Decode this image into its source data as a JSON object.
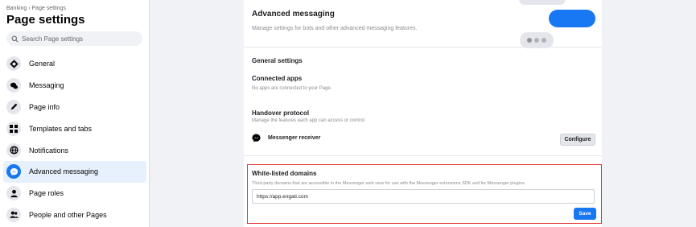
{
  "sidebar": {
    "breadcrumb": "Banking › Page settings",
    "title": "Page settings",
    "search_placeholder": "Search Page settings",
    "items": [
      {
        "label": "General",
        "icon": "gear-icon"
      },
      {
        "label": "Messaging",
        "icon": "chat-bubbles-icon"
      },
      {
        "label": "Page info",
        "icon": "pencil-icon"
      },
      {
        "label": "Templates and tabs",
        "icon": "grid-icon"
      },
      {
        "label": "Notifications",
        "icon": "globe-icon"
      },
      {
        "label": "Advanced messaging",
        "icon": "messenger-icon",
        "active": true
      },
      {
        "label": "Page roles",
        "icon": "person-icon"
      },
      {
        "label": "People and other Pages",
        "icon": "people-icon"
      }
    ]
  },
  "main": {
    "title": "Advanced messaging",
    "subtitle": "Manage settings for bots and other advanced messaging features.",
    "general_settings": "General settings",
    "connected_apps": {
      "title": "Connected apps",
      "subtitle": "No apps are connected to your Page."
    },
    "handover": {
      "title": "Handover protocol",
      "subtitle": "Manage the features each app can access or control.",
      "receiver_label": "Messenger receiver",
      "configure_label": "Configure"
    },
    "whitelist": {
      "title": "White-listed domains",
      "subtitle": "Third-party domains that are accessible in the Messenger web view for use with the Messenger extensions SDK and for Messenger plugins.",
      "value": "https://app.engati.com",
      "save_label": "Save"
    }
  },
  "colors": {
    "accent": "#1877f2",
    "highlight_border": "#e53935",
    "active_bg": "#e7f0fd"
  }
}
